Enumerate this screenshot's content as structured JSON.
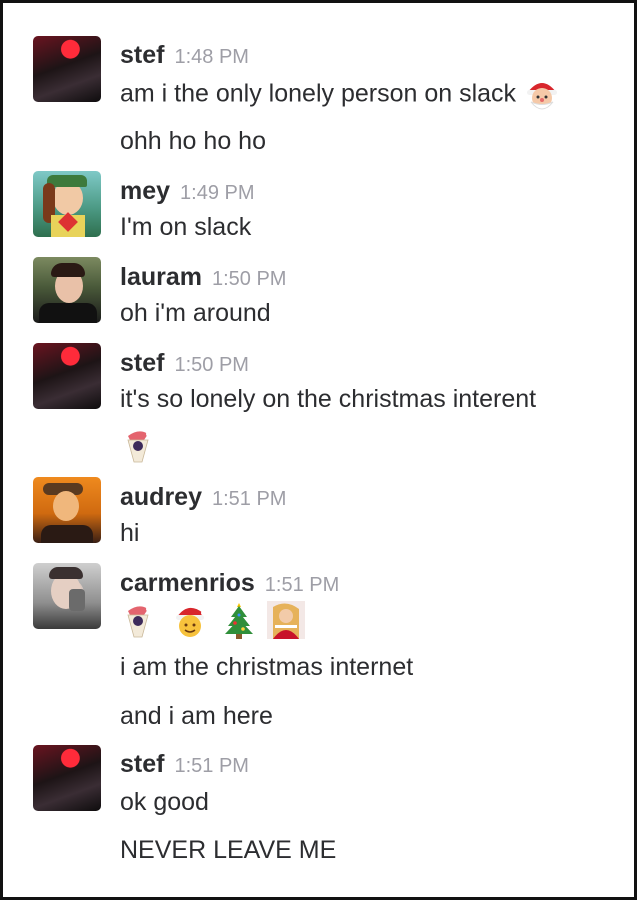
{
  "messages": [
    {
      "user": "stef",
      "time": "1:48 PM",
      "lines": [
        "am i the only lonely person on slack",
        "ohh ho ho ho"
      ],
      "emoji": [
        "santa-face-icon"
      ]
    },
    {
      "user": "mey",
      "time": "1:49 PM",
      "lines": [
        "I'm on slack"
      ]
    },
    {
      "user": "lauram",
      "time": "1:50 PM",
      "lines": [
        "oh i'm around"
      ]
    },
    {
      "user": "stef",
      "time": "1:50 PM",
      "lines": [
        "it's so lonely on the christmas interent"
      ],
      "emoji": [
        "mrs-claus-icon"
      ]
    },
    {
      "user": "audrey",
      "time": "1:51 PM",
      "lines": [
        "hi"
      ]
    },
    {
      "user": "carmenrios",
      "time": "1:51 PM",
      "lines": [
        "i am the christmas internet",
        "and i am here"
      ],
      "emoji": [
        "mrs-claus-icon",
        "santa-hat-face-icon",
        "christmas-tree-icon",
        "mariah-carey-icon"
      ]
    },
    {
      "user": "stef",
      "time": "1:51 PM",
      "lines": [
        "ok good",
        "NEVER LEAVE ME"
      ]
    }
  ],
  "colors": {
    "name": "#2c2d30",
    "timestamp": "#9e9ea6",
    "text": "#2c2d30",
    "border": "#111111"
  }
}
